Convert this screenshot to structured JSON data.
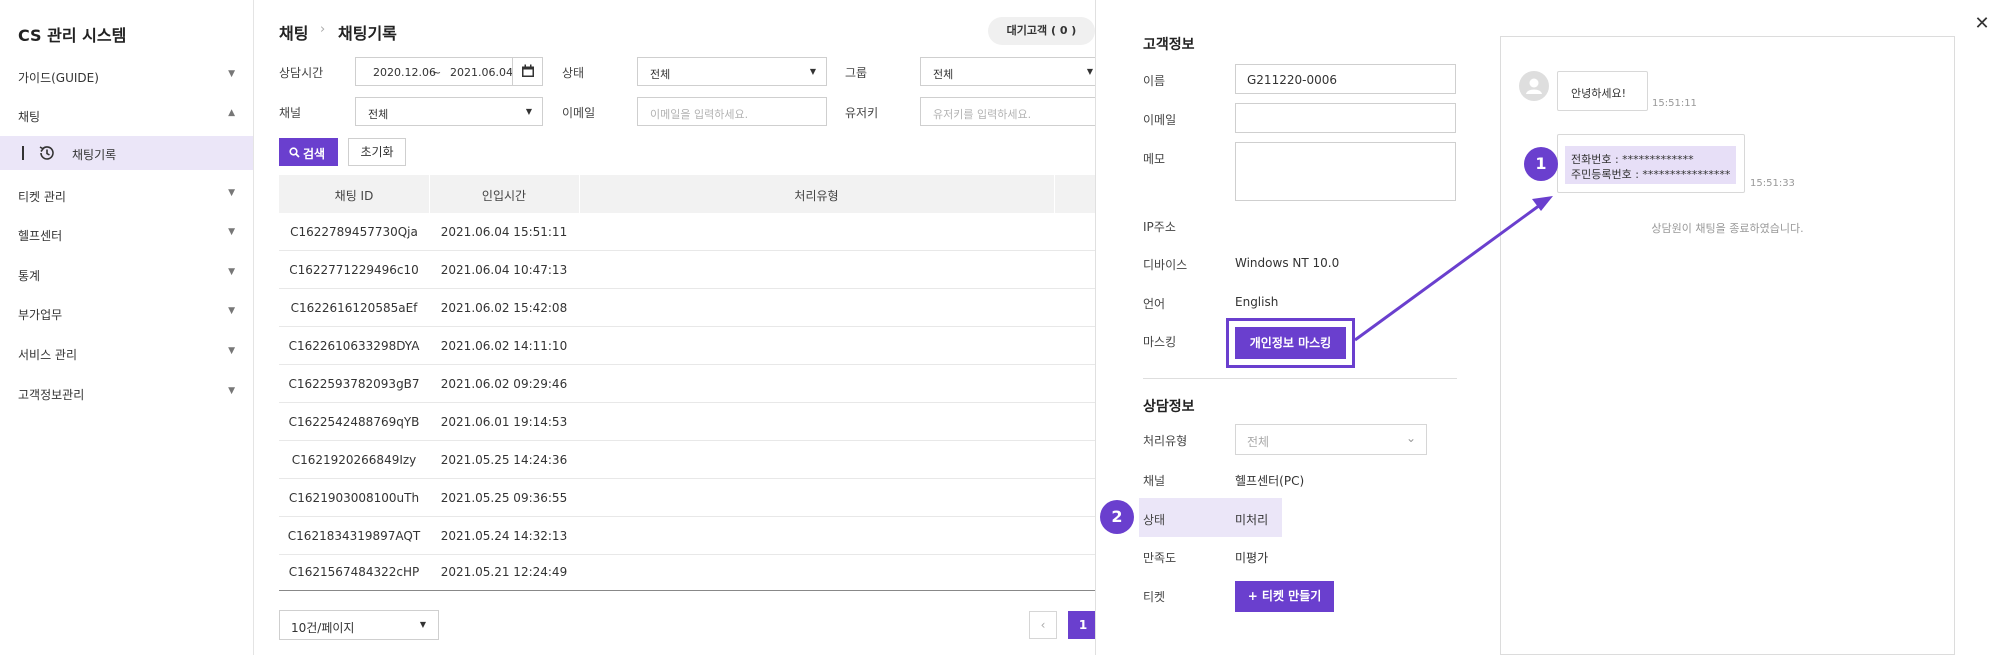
{
  "sidebar": {
    "title": "CS 관리 시스템",
    "items": [
      {
        "label": "가이드(GUIDE)"
      },
      {
        "label": "채팅"
      },
      {
        "label": "채팅기록"
      },
      {
        "label": "티켓 관리"
      },
      {
        "label": "헬프센터"
      },
      {
        "label": "통계"
      },
      {
        "label": "부가업무"
      },
      {
        "label": "서비스 관리"
      },
      {
        "label": "고객정보관리"
      }
    ]
  },
  "breadcrumb": {
    "root": "채팅",
    "current": "채팅기록",
    "separator": "›"
  },
  "waiting_button": "대기고객 ( 0 )",
  "filters": {
    "period_label": "상담시간",
    "date_from": "2020.12.06",
    "date_sep": "~",
    "date_to": "2021.06.04",
    "status_label": "상태",
    "status_value": "전체",
    "group_label": "그룹",
    "group_value": "전체",
    "channel_label": "채널",
    "channel_value": "전체",
    "email_label": "이메일",
    "email_placeholder": "이메일을 입력하세요.",
    "userkey_label": "유저키",
    "userkey_placeholder": "유저키를 입력하세요."
  },
  "buttons": {
    "search": "검색",
    "reset": "초기화"
  },
  "table": {
    "headers": [
      "채팅 ID",
      "인입시간",
      "처리유형"
    ],
    "rows": [
      {
        "id": "C1622789457730Qja",
        "time": "2021.06.04 15:51:11"
      },
      {
        "id": "C1622771229496c10",
        "time": "2021.06.04 10:47:13"
      },
      {
        "id": "C1622616120585aEf",
        "time": "2021.06.02 15:42:08"
      },
      {
        "id": "C1622610633298DYA",
        "time": "2021.06.02 14:11:10"
      },
      {
        "id": "C1622593782093gB7",
        "time": "2021.06.02 09:29:46"
      },
      {
        "id": "C1622542488769qYB",
        "time": "2021.06.01 19:14:53"
      },
      {
        "id": "C1621920266849Izy",
        "time": "2021.05.25 14:24:36"
      },
      {
        "id": "C1621903008100uTh",
        "time": "2021.05.25 09:36:55"
      },
      {
        "id": "C1621834319897AQT",
        "time": "2021.05.24 14:32:13"
      },
      {
        "id": "C1621567484322cHP",
        "time": "2021.05.21 12:24:49"
      }
    ]
  },
  "pagination": {
    "page_size": "10건/페이지",
    "prev": "‹",
    "current": "1"
  },
  "customer": {
    "title": "고객정보",
    "name_label": "이름",
    "name_value": "G211220-0006",
    "email_label": "이메일",
    "memo_label": "메모",
    "ip_label": "IP주소",
    "device_label": "디바이스",
    "device_value": "Windows NT 10.0",
    "lang_label": "언어",
    "lang_value": "English",
    "mask_label": "마스킹",
    "mask_button": "개인정보 마스킹"
  },
  "consult": {
    "title": "상담정보",
    "type_label": "처리유형",
    "type_value": "전체",
    "channel_label": "채널",
    "channel_value": "헬프센터(PC)",
    "status_label": "상태",
    "status_value": "미처리",
    "satisfaction_label": "만족도",
    "satisfaction_value": "미평가",
    "ticket_label": "티켓",
    "ticket_button": "+ 티켓 만들기"
  },
  "chat": {
    "greeting": "안녕하세요!",
    "greeting_time": "15:51:11",
    "masked_line1": "전화번호 : *************",
    "masked_line2": "주민등록번호 : ****************",
    "masked_time": "15:51:33",
    "end_message": "상담원이 채팅을 종료하였습니다."
  },
  "badges": {
    "one": "1",
    "two": "2"
  },
  "close_glyph": "✕",
  "colors": {
    "accent": "#6a3fce",
    "highlight": "#ebe6f8"
  }
}
